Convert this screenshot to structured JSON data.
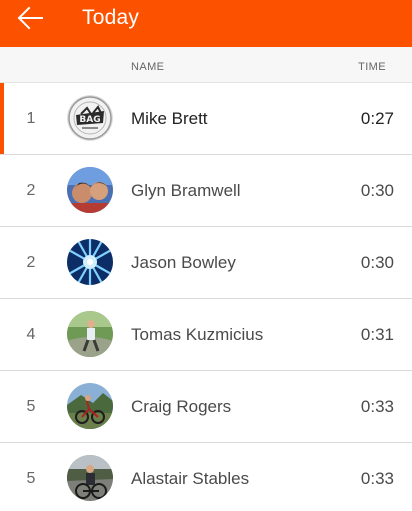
{
  "header": {
    "title": "Today",
    "back_icon": "arrow-left-icon",
    "color": "#fc5200"
  },
  "columns": {
    "name": "NAME",
    "time": "TIME"
  },
  "leaderboard": [
    {
      "rank": "1",
      "name": "Mike Brett",
      "time": "0:27",
      "highlighted": true,
      "avatar": "logo-avatar"
    },
    {
      "rank": "2",
      "name": "Glyn Bramwell",
      "time": "0:30",
      "highlighted": false,
      "avatar": "photo-avatar"
    },
    {
      "rank": "2",
      "name": "Jason Bowley",
      "time": "0:30",
      "highlighted": false,
      "avatar": "photo-avatar"
    },
    {
      "rank": "4",
      "name": "Tomas Kuzmicius",
      "time": "0:31",
      "highlighted": false,
      "avatar": "photo-avatar"
    },
    {
      "rank": "5",
      "name": "Craig Rogers",
      "time": "0:33",
      "highlighted": false,
      "avatar": "photo-avatar"
    },
    {
      "rank": "5",
      "name": "Alastair Stables",
      "time": "0:33",
      "highlighted": false,
      "avatar": "photo-avatar"
    }
  ]
}
